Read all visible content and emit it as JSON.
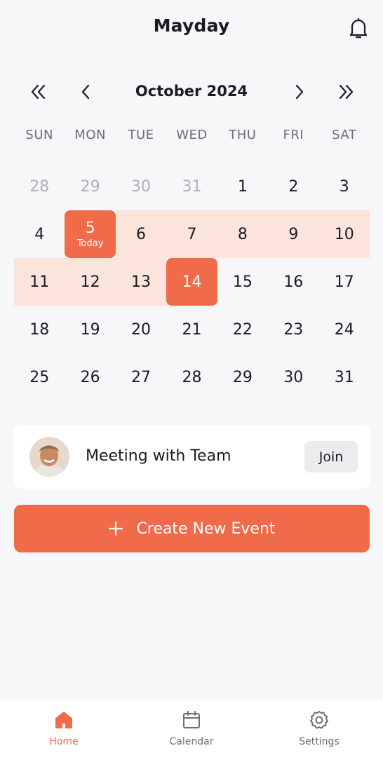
{
  "header": {
    "title": "Mayday",
    "bell_icon": "bell-icon"
  },
  "calendar": {
    "month_label": "October 2024",
    "nav_icons": [
      "double-chevron-left-icon",
      "chevron-left-icon",
      "chevron-right-icon",
      "double-chevron-right-icon"
    ],
    "weekdays": [
      "SUN",
      "MON",
      "TUE",
      "WED",
      "THU",
      "FRI",
      "SAT"
    ],
    "weeks": [
      [
        {
          "d": "28",
          "muted": true
        },
        {
          "d": "29",
          "muted": true
        },
        {
          "d": "30",
          "muted": true
        },
        {
          "d": "31",
          "muted": true
        },
        {
          "d": "1"
        },
        {
          "d": "2"
        },
        {
          "d": "3"
        }
      ],
      [
        {
          "d": "4"
        },
        {
          "d": "5",
          "state": "today"
        },
        {
          "d": "6",
          "state": "range"
        },
        {
          "d": "7",
          "state": "range"
        },
        {
          "d": "8",
          "state": "range"
        },
        {
          "d": "9",
          "state": "range"
        },
        {
          "d": "10",
          "state": "range"
        }
      ],
      [
        {
          "d": "11",
          "state": "range"
        },
        {
          "d": "12",
          "state": "range"
        },
        {
          "d": "13",
          "state": "range"
        },
        {
          "d": "14",
          "state": "selected"
        },
        {
          "d": "15"
        },
        {
          "d": "16"
        },
        {
          "d": "17"
        }
      ],
      [
        {
          "d": "18"
        },
        {
          "d": "19"
        },
        {
          "d": "20"
        },
        {
          "d": "21"
        },
        {
          "d": "22"
        },
        {
          "d": "23"
        },
        {
          "d": "24"
        }
      ],
      [
        {
          "d": "25"
        },
        {
          "d": "26"
        },
        {
          "d": "27"
        },
        {
          "d": "28"
        },
        {
          "d": "29"
        },
        {
          "d": "30"
        },
        {
          "d": "31"
        }
      ]
    ],
    "today_label": "Today"
  },
  "event": {
    "title": "Meeting with Team",
    "join_label": "Join"
  },
  "create_button": {
    "label": "Create New Event",
    "icon": "plus-icon"
  },
  "tabbar": {
    "items": [
      {
        "label": "Home",
        "icon": "home-icon",
        "active": true
      },
      {
        "label": "Calendar",
        "icon": "calendar-icon",
        "active": false
      },
      {
        "label": "Settings",
        "icon": "settings-icon",
        "active": false
      }
    ]
  },
  "colors": {
    "accent": "#ef6b4a",
    "range": "#fbe4dc",
    "background": "#f7f7f9"
  }
}
